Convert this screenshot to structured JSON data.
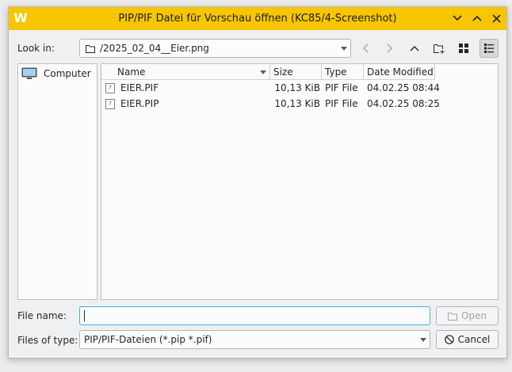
{
  "window": {
    "title": "PIP/PIF Datei für Vorschau öffnen (KC85/4-Screenshot)",
    "app_icon_glyph": "W"
  },
  "toolbar": {
    "look_in_label": "Look in:",
    "look_in_value": "/2025_02_04__Eier.png"
  },
  "sidebar": {
    "items": [
      {
        "label": "Computer",
        "icon": "computer-icon"
      }
    ]
  },
  "file_list": {
    "columns": [
      "Name",
      "Size",
      "Type",
      "Date Modified"
    ],
    "rows": [
      {
        "name": "EIER.PIF",
        "size": "10,13 KiB",
        "type": "PIF File",
        "modified": "04.02.25 08:44"
      },
      {
        "name": "EIER.PIP",
        "size": "10,13 KiB",
        "type": "PIF File",
        "modified": "04.02.25 08:25"
      }
    ]
  },
  "form": {
    "file_name_label": "File name:",
    "file_name_value": "",
    "files_of_type_label": "Files of type:",
    "files_of_type_value": "PIP/PIF-Dateien (*.pip *.pif)"
  },
  "buttons": {
    "open_label": "Open",
    "cancel_label": "Cancel"
  },
  "colors": {
    "titlebar": "#f7c600",
    "focus_border": "#3daee9"
  }
}
